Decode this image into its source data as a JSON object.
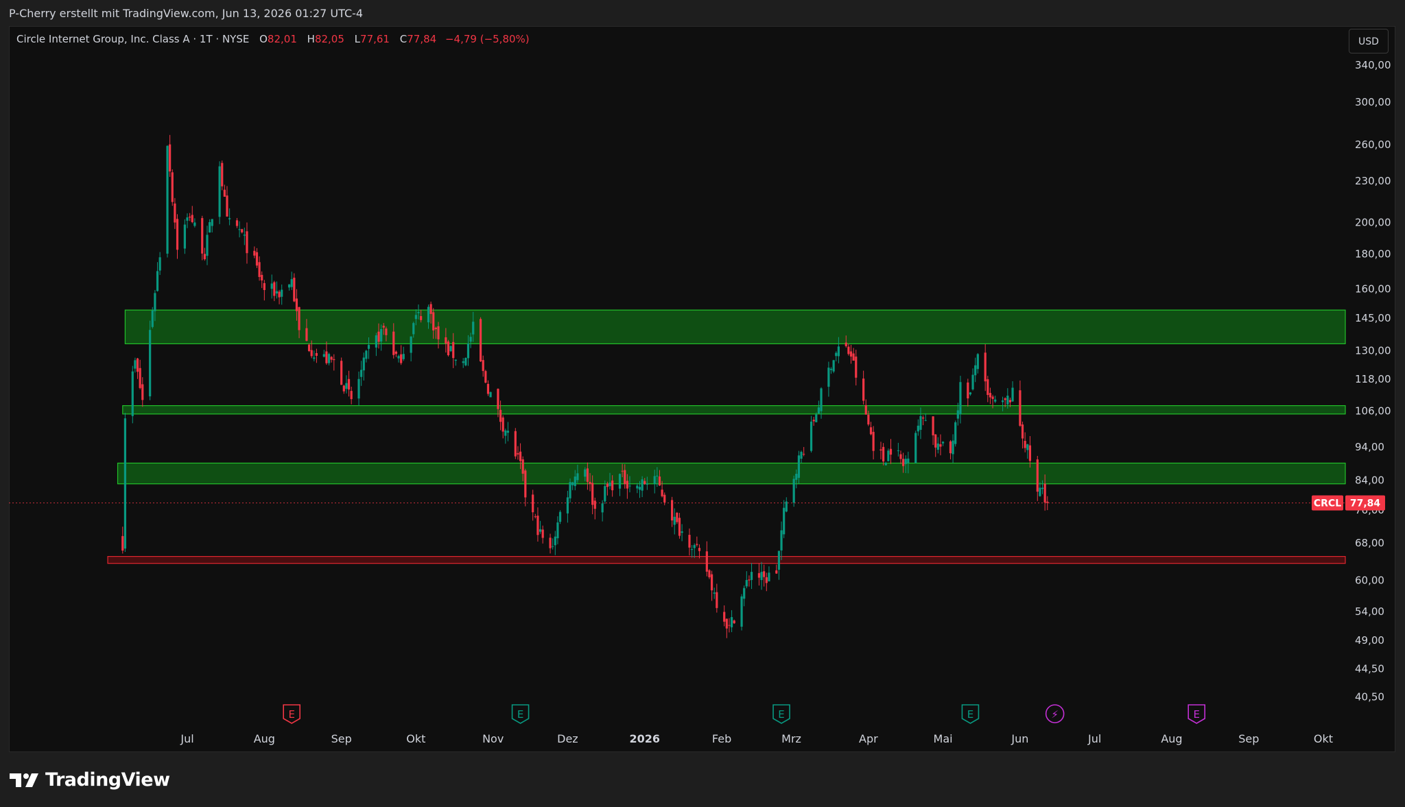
{
  "header": {
    "credit": "P-Cherry erstellt mit TradingView.com, Jun 13, 2026 01:27 UTC-4"
  },
  "legend": {
    "symbol": "Circle Internet Group, Inc. Class A · 1T · NYSE",
    "open_label": "O",
    "open": "82,01",
    "high_label": "H",
    "high": "82,05",
    "low_label": "L",
    "low": "77,61",
    "close_label": "C",
    "close": "77,84",
    "change": "−4,79 (−5,80%)"
  },
  "currency_button": "USD",
  "price_badge": {
    "ticker": "CRCL",
    "price": "77,84",
    "color": "#f23645"
  },
  "brand": {
    "name": "TradingView"
  },
  "colors": {
    "up": "#089981",
    "down": "#f23645",
    "zone_green": "#0f7a16",
    "zone_red": "#7a0f12"
  },
  "chart_data": {
    "type": "candlestick",
    "symbol": "CRCL",
    "scale": "log",
    "y_ticks": [
      "340,00",
      "300,00",
      "260,00",
      "230,00",
      "200,00",
      "180,00",
      "160,00",
      "145,00",
      "130,00",
      "118,00",
      "106,00",
      "94,00",
      "84,00",
      "76,00",
      "68,00",
      "60,00",
      "54,00",
      "49,00",
      "44,50",
      "40,50"
    ],
    "y_tick_values": [
      340,
      300,
      260,
      230,
      200,
      180,
      160,
      145,
      130,
      118,
      106,
      94,
      84,
      76,
      68,
      60,
      54,
      49,
      44.5,
      40.5
    ],
    "x_ticks": [
      "Jul",
      "Aug",
      "Sep",
      "Okt",
      "Nov",
      "Dez",
      "2026",
      "Feb",
      "Mrz",
      "Apr",
      "Mai",
      "Jun",
      "Jul",
      "Aug",
      "Sep",
      "Okt"
    ],
    "x_tick_dates": [
      "2025-07-01",
      "2025-08-01",
      "2025-09-01",
      "2025-10-01",
      "2025-11-01",
      "2025-12-01",
      "2026-01-01",
      "2026-02-01",
      "2026-03-01",
      "2026-04-01",
      "2026-05-01",
      "2026-06-01",
      "2026-07-01",
      "2026-08-01",
      "2026-09-01",
      "2026-10-01"
    ],
    "last_price": 77.84,
    "zones": [
      {
        "type": "resistance",
        "low": 133,
        "high": 149,
        "from": "2025-06-06"
      },
      {
        "type": "support",
        "low": 105,
        "high": 108,
        "from": "2025-06-05"
      },
      {
        "type": "support",
        "low": 83,
        "high": 89,
        "from": "2025-06-03"
      },
      {
        "type": "support",
        "low": 63.5,
        "high": 65,
        "from": "2025-05-30",
        "color": "red"
      }
    ],
    "events": [
      {
        "date": "2025-08-12",
        "type": "earnings",
        "label": "E",
        "status": "negative"
      },
      {
        "date": "2025-11-12",
        "type": "earnings",
        "label": "E",
        "status": "positive"
      },
      {
        "date": "2026-02-25",
        "type": "earnings",
        "label": "E",
        "status": "positive"
      },
      {
        "date": "2026-05-12",
        "type": "earnings",
        "label": "E",
        "status": "positive"
      },
      {
        "date": "2026-06-15",
        "type": "split-dividend",
        "label": "⚡",
        "status": "upcoming"
      },
      {
        "date": "2026-08-11",
        "type": "earnings",
        "label": "E",
        "status": "upcoming"
      }
    ],
    "keypoints": [
      [
        "2025-06-05",
        68
      ],
      [
        "2025-06-06",
        105
      ],
      [
        "2025-06-10",
        125
      ],
      [
        "2025-06-13",
        110
      ],
      [
        "2025-06-17",
        150
      ],
      [
        "2025-06-20",
        180
      ],
      [
        "2025-06-23",
        263
      ],
      [
        "2025-06-25",
        218
      ],
      [
        "2025-06-27",
        185
      ],
      [
        "2025-07-02",
        206
      ],
      [
        "2025-07-08",
        180
      ],
      [
        "2025-07-11",
        205
      ],
      [
        "2025-07-14",
        245
      ],
      [
        "2025-07-17",
        200
      ],
      [
        "2025-07-22",
        195
      ],
      [
        "2025-07-28",
        175
      ],
      [
        "2025-08-01",
        160
      ],
      [
        "2025-08-07",
        158
      ],
      [
        "2025-08-12",
        165
      ],
      [
        "2025-08-15",
        138
      ],
      [
        "2025-08-22",
        128
      ],
      [
        "2025-08-29",
        125
      ],
      [
        "2025-09-05",
        110
      ],
      [
        "2025-09-12",
        130
      ],
      [
        "2025-09-18",
        140
      ],
      [
        "2025-09-24",
        125
      ],
      [
        "2025-10-01",
        145
      ],
      [
        "2025-10-06",
        150
      ],
      [
        "2025-10-10",
        135
      ],
      [
        "2025-10-14",
        130
      ],
      [
        "2025-10-20",
        125
      ],
      [
        "2025-10-24",
        140
      ],
      [
        "2025-10-28",
        120
      ],
      [
        "2025-11-03",
        105
      ],
      [
        "2025-11-07",
        98
      ],
      [
        "2025-11-12",
        88
      ],
      [
        "2025-11-14",
        80
      ],
      [
        "2025-11-20",
        70
      ],
      [
        "2025-11-24",
        66
      ],
      [
        "2025-11-28",
        75
      ],
      [
        "2025-12-03",
        85
      ],
      [
        "2025-12-08",
        88
      ],
      [
        "2025-12-12",
        76
      ],
      [
        "2025-12-17",
        82
      ],
      [
        "2025-12-22",
        85
      ],
      [
        "2025-12-29",
        82
      ],
      [
        "2026-01-05",
        85
      ],
      [
        "2026-01-09",
        79
      ],
      [
        "2026-01-14",
        72
      ],
      [
        "2026-01-20",
        68
      ],
      [
        "2026-01-26",
        62
      ],
      [
        "2026-01-30",
        56
      ],
      [
        "2026-02-04",
        51
      ],
      [
        "2026-02-10",
        58
      ],
      [
        "2026-02-13",
        62
      ],
      [
        "2026-02-18",
        60
      ],
      [
        "2026-02-23",
        62
      ],
      [
        "2026-02-26",
        75
      ],
      [
        "2026-03-03",
        88
      ],
      [
        "2026-03-09",
        100
      ],
      [
        "2026-03-13",
        112
      ],
      [
        "2026-03-17",
        125
      ],
      [
        "2026-03-21",
        133
      ],
      [
        "2026-03-25",
        128
      ],
      [
        "2026-03-30",
        108
      ],
      [
        "2026-04-03",
        95
      ],
      [
        "2026-04-07",
        90
      ],
      [
        "2026-04-11",
        95
      ],
      [
        "2026-04-15",
        88
      ],
      [
        "2026-04-20",
        100
      ],
      [
        "2026-04-24",
        105
      ],
      [
        "2026-04-28",
        95
      ],
      [
        "2026-05-04",
        92
      ],
      [
        "2026-05-08",
        115
      ],
      [
        "2026-05-12",
        112
      ],
      [
        "2026-05-15",
        130
      ],
      [
        "2026-05-19",
        110
      ],
      [
        "2026-05-25",
        108
      ],
      [
        "2026-05-29",
        112
      ],
      [
        "2026-06-02",
        98
      ],
      [
        "2026-06-05",
        90
      ],
      [
        "2026-06-08",
        80
      ],
      [
        "2026-06-10",
        82
      ],
      [
        "2026-06-12",
        77.84
      ]
    ],
    "grid": false,
    "legend_position": "top-left"
  }
}
